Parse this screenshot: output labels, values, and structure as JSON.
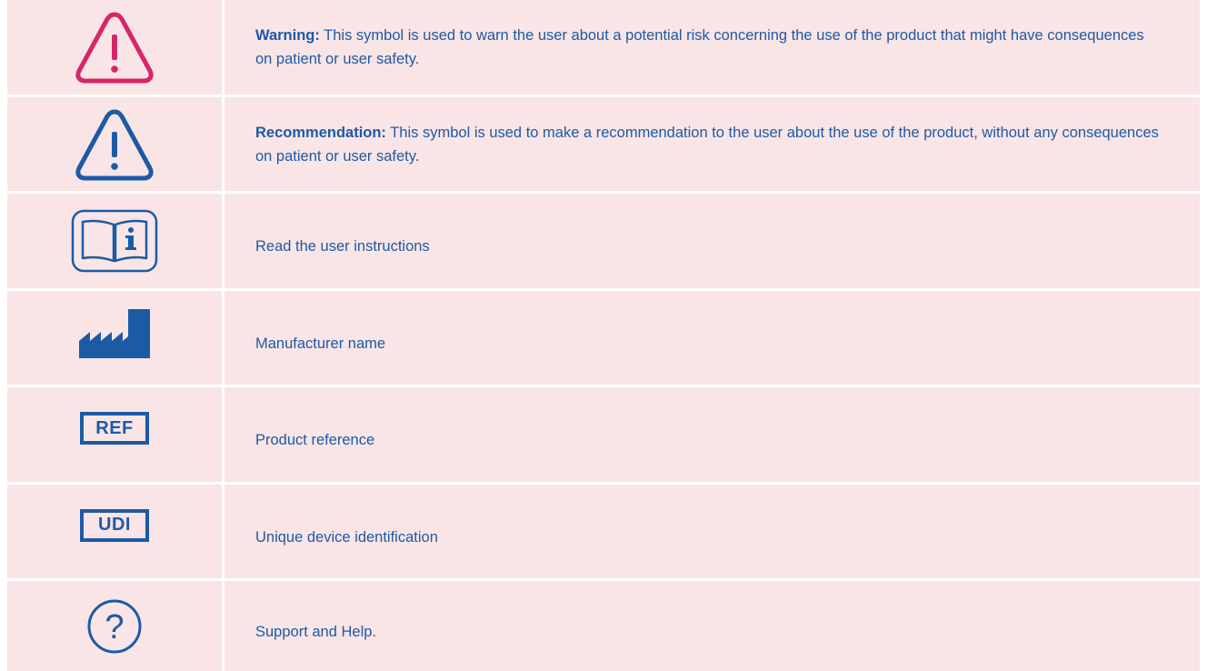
{
  "colors": {
    "row_background": "#f9e5e6",
    "divider": "#ffffff",
    "text": "#1d5aa6",
    "warning_icon": "#d6266a",
    "symbol_blue": "#1d5aa6"
  },
  "rows": [
    {
      "icon": "warning-triangle-icon",
      "label": "Warning:",
      "text": " This symbol is used to warn the user about a potential risk concerning the use of the product that might have consequences on patient or user safety."
    },
    {
      "icon": "recommendation-triangle-icon",
      "label": "Recommendation:",
      "text": " This symbol is used to make a recommendation to the user about the use of the product, without any consequences on patient or user safety."
    },
    {
      "icon": "instructions-book-icon",
      "text": "Read the user instructions"
    },
    {
      "icon": "manufacturer-factory-icon",
      "text": "Manufacturer name"
    },
    {
      "icon": "ref-icon",
      "icon_text": "REF",
      "text": "Product reference"
    },
    {
      "icon": "udi-icon",
      "icon_text": "UDI",
      "text": "Unique device identification"
    },
    {
      "icon": "help-question-icon",
      "icon_text": "?",
      "text": "Support and Help."
    }
  ]
}
